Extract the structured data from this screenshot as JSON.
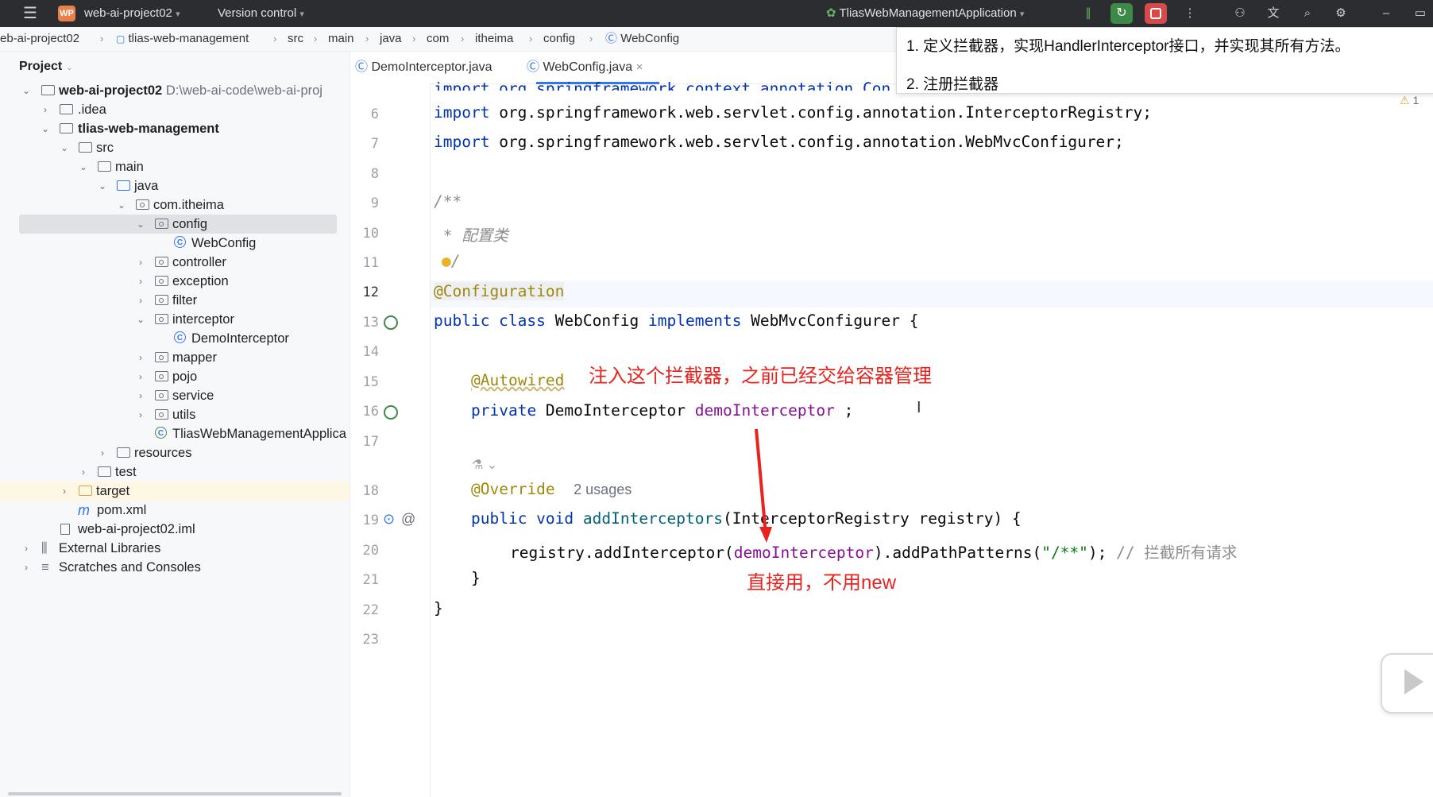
{
  "titlebar": {
    "logo_text": "WP",
    "project": "web-ai-project02",
    "vcs": "Version control",
    "run_config": "TliasWebManagementApplication"
  },
  "breadcrumb": [
    "eb-ai-project02",
    "tlias-web-management",
    "src",
    "main",
    "java",
    "com",
    "itheima",
    "config",
    "WebConfig"
  ],
  "popup": {
    "line1": "1. 定义拦截器，实现HandlerInterceptor接口，并实现其所有方法。",
    "line2": "2. 注册拦截器"
  },
  "sidebar": {
    "title": "Project",
    "items": [
      {
        "label": "web-ai-project02",
        "path": "D:\\web-ai-code\\web-ai-proj"
      },
      {
        "label": ".idea"
      },
      {
        "label": "tlias-web-management"
      },
      {
        "label": "src"
      },
      {
        "label": "main"
      },
      {
        "label": "java"
      },
      {
        "label": "com.itheima"
      },
      {
        "label": "config"
      },
      {
        "label": "WebConfig"
      },
      {
        "label": "controller"
      },
      {
        "label": "exception"
      },
      {
        "label": "filter"
      },
      {
        "label": "interceptor"
      },
      {
        "label": "DemoInterceptor"
      },
      {
        "label": "mapper"
      },
      {
        "label": "pojo"
      },
      {
        "label": "service"
      },
      {
        "label": "utils"
      },
      {
        "label": "TliasWebManagementApplica"
      },
      {
        "label": "resources"
      },
      {
        "label": "test"
      },
      {
        "label": "target"
      },
      {
        "label": "pom.xml"
      },
      {
        "label": "web-ai-project02.iml"
      },
      {
        "label": "External Libraries"
      },
      {
        "label": "Scratches and Consoles"
      }
    ]
  },
  "tabs": [
    {
      "label": "DemoInterceptor.java"
    },
    {
      "label": "WebConfig.java",
      "close": "×"
    }
  ],
  "editor": {
    "line_numbers": [
      "6",
      "7",
      "8",
      "9",
      "10",
      "11",
      "12",
      "13",
      "14",
      "15",
      "16",
      "17",
      "18",
      "19",
      "20",
      "21",
      "22",
      "23"
    ],
    "warning_count": "1",
    "code": {
      "l5_partial": "import org.springframework.context.annotation.Con",
      "l6_kw": "import",
      "l6_rest": " org.springframework.web.servlet.config.annotation.InterceptorRegistry;",
      "l7_kw": "import",
      "l7_rest": " org.springframework.web.servlet.config.annotation.WebMvcConfigurer;",
      "l9": "/**",
      "l10": " * 配置类",
      "l11": "/",
      "l12": "@Configuration",
      "l13_kw1": "public class",
      "l13_name": " WebConfig ",
      "l13_kw2": "implements",
      "l13_rest": " WebMvcConfigurer {",
      "l15": "@Autowired",
      "l16_kw": "private",
      "l16_type": " DemoInterceptor ",
      "l16_field": "demoInterceptor",
      "l16_end": " ;",
      "l18_ann": "@Override",
      "l18_usages": "2 usages",
      "l19_kw": "public void",
      "l19_method": " addInterceptors",
      "l19_rest": "(InterceptorRegistry registry) {",
      "l20_a": "registry.addInterceptor(",
      "l20_field": "demoInterceptor",
      "l20_b": ").addPathPatterns(",
      "l20_str": "\"/**\"",
      "l20_c": "); ",
      "l20_cmt": "// 拦截所有请求",
      "l21": "}",
      "l22": "}"
    }
  },
  "annotations": {
    "note1": "注入这个拦截器，之前已经交给容器管理",
    "note2": "直接用，不用new",
    "arrow_color": "#e8231e"
  },
  "colors": {
    "keyword": "#0033b3",
    "annotation": "#9e880d",
    "field": "#871094",
    "string": "#067d17",
    "comment": "#8c8c8c",
    "accent": "#3574f0"
  }
}
